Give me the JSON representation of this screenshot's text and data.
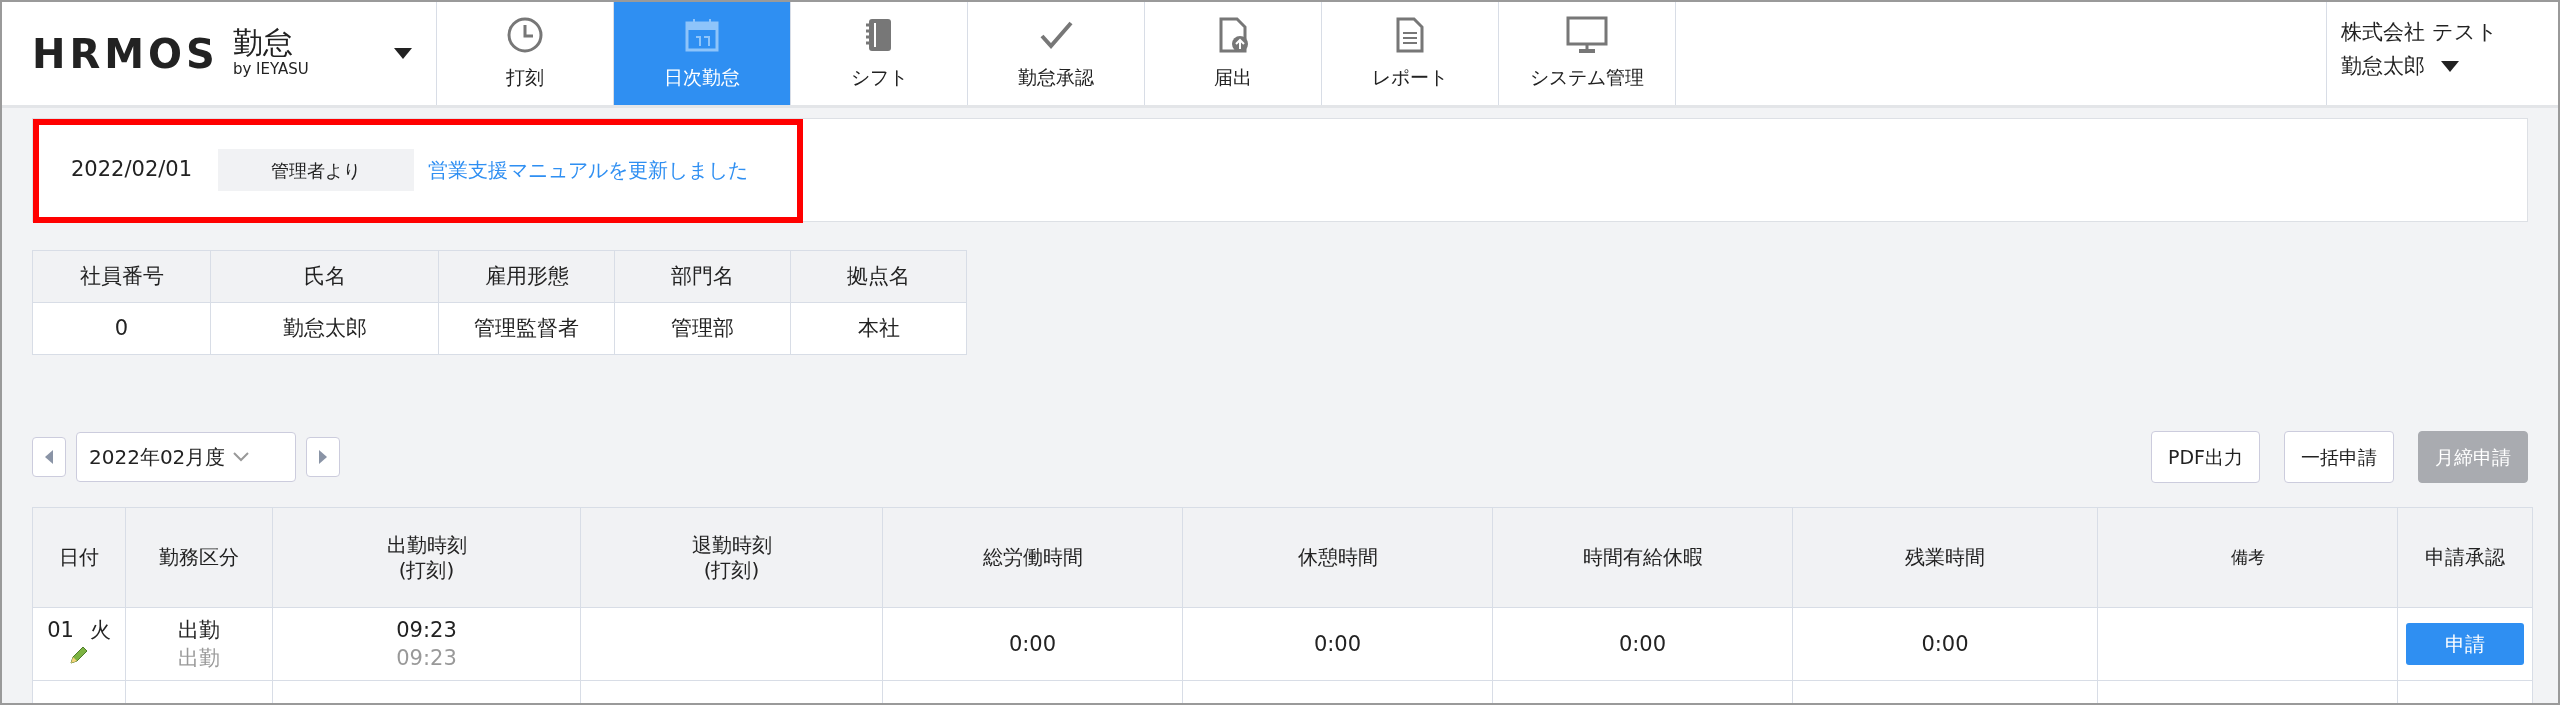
{
  "header": {
    "logo": {
      "wordmark": "HRMOS",
      "product": "勤怠",
      "byline": "by IEYASU"
    },
    "nav": [
      {
        "label": "打刻",
        "selected": false
      },
      {
        "label": "日次勤怠",
        "selected": true
      },
      {
        "label": "シフト",
        "selected": false
      },
      {
        "label": "勤怠承認",
        "selected": false
      },
      {
        "label": "届出",
        "selected": false
      },
      {
        "label": "レポート",
        "selected": false
      },
      {
        "label": "システム管理",
        "selected": false
      }
    ],
    "user": {
      "company": "株式会社 テスト",
      "name": "勤怠太郎"
    }
  },
  "notice": {
    "date": "2022/02/01",
    "source": "管理者より",
    "message": "営業支援マニュアルを更新しました",
    "highlighted": true
  },
  "employee_table": {
    "columns": [
      "社員番号",
      "氏名",
      "雇用形態",
      "部門名",
      "拠点名"
    ],
    "rows": [
      [
        "0",
        "勤怠太郎",
        "管理監督者",
        "管理部",
        "本社"
      ]
    ]
  },
  "period": {
    "value": "2022年02月度"
  },
  "actions": [
    {
      "label": "PDF出力",
      "disabled": false
    },
    {
      "label": "一括申請",
      "disabled": false
    },
    {
      "label": "月締申請",
      "disabled": true
    }
  ],
  "attendance": {
    "columns": [
      {
        "label": "日付"
      },
      {
        "label": "勤務区分"
      },
      {
        "label": "出勤時刻",
        "sub": "(打刻)"
      },
      {
        "label": "退勤時刻",
        "sub": "(打刻)"
      },
      {
        "label": "総労働時間"
      },
      {
        "label": "休憩時間"
      },
      {
        "label": "時間有給休暇"
      },
      {
        "label": "残業時間"
      },
      {
        "label": "備考",
        "small": true
      },
      {
        "label": "申請承認"
      }
    ],
    "rows": [
      {
        "date": "01",
        "weekday": "火",
        "editable": true,
        "work_type": "出勤",
        "work_type_actual": "出勤",
        "clock_in": "09:23",
        "clock_in_stamp": "09:23",
        "total": "0:00",
        "break": "0:00",
        "paid_leave": "0:00",
        "overtime": "0:00",
        "action": "申請"
      }
    ]
  }
}
